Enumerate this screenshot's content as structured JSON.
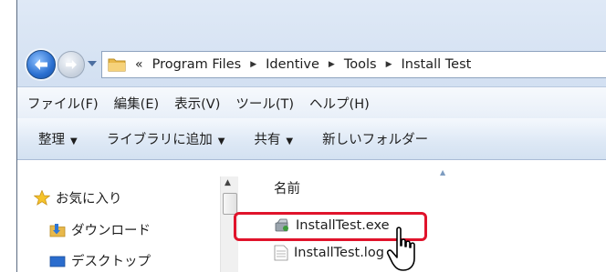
{
  "address": {
    "overflow": "«",
    "crumbs": [
      "Program Files",
      "Identive",
      "Tools",
      "Install Test"
    ]
  },
  "menubar": {
    "items": [
      "ファイル(F)",
      "編集(E)",
      "表示(V)",
      "ツール(T)",
      "ヘルプ(H)"
    ]
  },
  "toolbar": {
    "organize": "整理",
    "add_library": "ライブラリに追加",
    "share": "共有",
    "new_folder": "新しいフォルダー"
  },
  "navpane": {
    "favorites": "お気に入り",
    "downloads": "ダウンロード",
    "desktop": "デスクトップ"
  },
  "filelist": {
    "column_name": "名前",
    "files": [
      "InstallTest.exe",
      "InstallTest.log"
    ]
  },
  "colors": {
    "highlight": "#e0132b",
    "window_frame": "#c9d9ee"
  },
  "icons": {
    "back": "back-arrow-icon",
    "forward": "forward-arrow-icon",
    "folder": "folder-icon",
    "favorites": "star-icon",
    "downloads": "download-folder-icon",
    "desktop": "desktop-icon",
    "exe": "installer-icon",
    "log": "text-file-icon",
    "cursor": "hand-pointer-icon"
  }
}
